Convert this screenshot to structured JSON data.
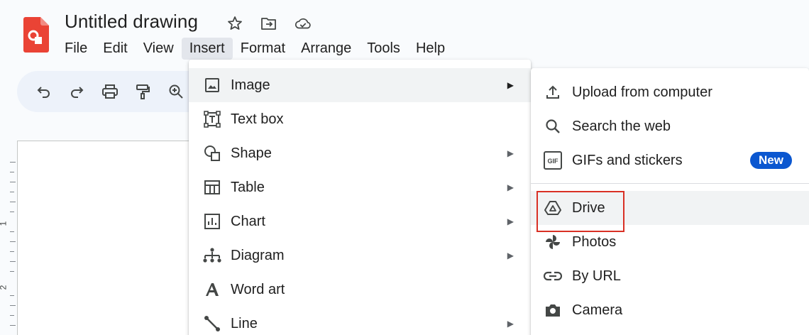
{
  "app": {
    "title": "Untitled drawing",
    "logo_icon": "google-drawings-logo"
  },
  "title_icons": [
    "star-icon",
    "move-to-folder-icon",
    "cloud-saved-icon"
  ],
  "menubar": {
    "items": [
      {
        "label": "File"
      },
      {
        "label": "Edit"
      },
      {
        "label": "View"
      },
      {
        "label": "Insert"
      },
      {
        "label": "Format"
      },
      {
        "label": "Arrange"
      },
      {
        "label": "Tools"
      },
      {
        "label": "Help"
      }
    ],
    "active": "Insert"
  },
  "toolbar": {
    "icons": [
      "undo-icon",
      "redo-icon",
      "print-icon",
      "paint-format-icon",
      "zoom-icon"
    ]
  },
  "ruler": {
    "labels": [
      "1",
      "2"
    ]
  },
  "insert_menu": {
    "items": [
      {
        "label": "Image",
        "icon": "image-icon",
        "submenu": true,
        "hovered": true
      },
      {
        "label": "Text box",
        "icon": "text-box-icon",
        "submenu": false
      },
      {
        "label": "Shape",
        "icon": "shape-icon",
        "submenu": true
      },
      {
        "label": "Table",
        "icon": "table-icon",
        "submenu": true
      },
      {
        "label": "Chart",
        "icon": "chart-icon",
        "submenu": true
      },
      {
        "label": "Diagram",
        "icon": "diagram-icon",
        "submenu": true
      },
      {
        "label": "Word art",
        "icon": "word-art-icon",
        "submenu": false
      },
      {
        "label": "Line",
        "icon": "line-icon",
        "submenu": true
      }
    ],
    "arrow_glyph": "▶"
  },
  "image_menu": {
    "items": [
      {
        "label": "Upload from computer",
        "icon": "upload-icon"
      },
      {
        "label": "Search the web",
        "icon": "search-icon"
      },
      {
        "label": "GIFs and stickers",
        "icon": "gif-icon",
        "badge": "New"
      },
      {
        "label": "Drive",
        "icon": "drive-icon",
        "highlighted": true
      },
      {
        "label": "Photos",
        "icon": "photos-icon"
      },
      {
        "label": "By URL",
        "icon": "link-icon"
      },
      {
        "label": "Camera",
        "icon": "camera-icon"
      }
    ]
  },
  "colors": {
    "accent": "#0b57d0",
    "highlight_border": "#d93025",
    "logo": "#ea4335",
    "toolbar_bg": "#edf2fa"
  }
}
